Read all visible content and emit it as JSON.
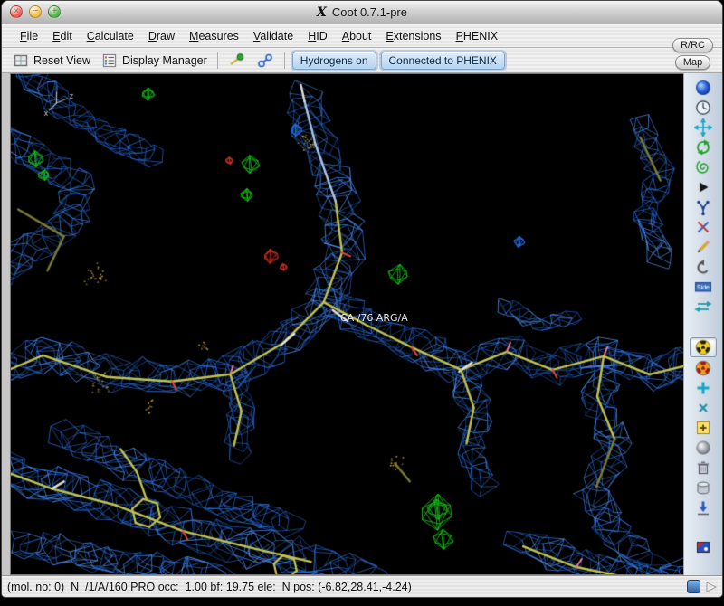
{
  "window": {
    "title": "Coot 0.7.1-pre",
    "icon_glyph": "X"
  },
  "traffic_lights": [
    {
      "name": "close-button",
      "glyph": "×",
      "color": "#f25a52"
    },
    {
      "name": "minimize-button",
      "glyph": "−",
      "color": "#f6bd3e"
    },
    {
      "name": "zoom-button",
      "glyph": "+",
      "color": "#51b946"
    }
  ],
  "menubar": {
    "items": [
      "File",
      "Edit",
      "Calculate",
      "Draw",
      "Measures",
      "Validate",
      "HID",
      "About",
      "Extensions",
      "PHENIX"
    ]
  },
  "corner_buttons": {
    "rrc": "R/RC",
    "map": "Map"
  },
  "toolbar": {
    "reset_view": "Reset View",
    "display_manager": "Display Manager",
    "toggles": [
      {
        "label": "Hydrogens on"
      },
      {
        "label": "Connected to PHENIX"
      }
    ]
  },
  "scene": {
    "atom_label": "CA /76 ARG/A",
    "axis_labels": [
      "x",
      "z"
    ],
    "colors": {
      "mesh": "#2a6fe0",
      "mesh2": "#4f8ef2",
      "green": "#1ac01a",
      "red": "#d83020",
      "sticks": "#c2c24e",
      "dim": "#7c7c34",
      "white": "#e0e0e0",
      "lightblue": "#a8c6e6",
      "dots": "#c8a028",
      "tick_red": "#e04438",
      "tick_pink": "#e87898"
    }
  },
  "right_toolbar": {
    "side_label": "Side",
    "icons": [
      {
        "name": "view-sphere-icon",
        "draw": "sphere_blue"
      },
      {
        "name": "clock-icon",
        "draw": "clock"
      },
      {
        "name": "move-atoms-icon",
        "draw": "move"
      },
      {
        "name": "rotate-translate-icon",
        "draw": "rotate"
      },
      {
        "name": "refine-spiral-icon",
        "draw": "spiral"
      },
      {
        "name": "play-icon",
        "draw": "play"
      },
      {
        "name": "rotamer-icon",
        "draw": "rotamer"
      },
      {
        "name": "chi-angles-icon",
        "draw": "chi"
      },
      {
        "name": "pencil-icon",
        "draw": "pencil"
      },
      {
        "name": "undo-icon",
        "draw": "undo"
      },
      {
        "name": "side-chain-icon",
        "draw": "side"
      },
      {
        "name": "flip-icon",
        "draw": "flip"
      },
      {
        "name": "radiation-yellow-icon",
        "draw": "rad_y",
        "pressed": true,
        "gap": true
      },
      {
        "name": "radiation-red-icon",
        "draw": "rad_r"
      },
      {
        "name": "add-atom-icon",
        "draw": "plus_cyan"
      },
      {
        "name": "delete-x-icon",
        "draw": "x_small"
      },
      {
        "name": "add-residue-icon",
        "draw": "plus_square"
      },
      {
        "name": "grey-sphere-icon",
        "draw": "sphere_grey"
      },
      {
        "name": "trash-icon",
        "draw": "trash"
      },
      {
        "name": "cylinder-icon",
        "draw": "cylinder"
      },
      {
        "name": "arrow-down-icon",
        "draw": "arrow_down"
      },
      {
        "name": "flag-icon",
        "draw": "flag",
        "gap": true
      }
    ]
  },
  "statusbar": {
    "text": "(mol. no: 0)  N  /1/A/160 PRO occ:  1.00 bf: 19.75 ele:  N pos: (-6.82,28.41,-4.24)"
  }
}
